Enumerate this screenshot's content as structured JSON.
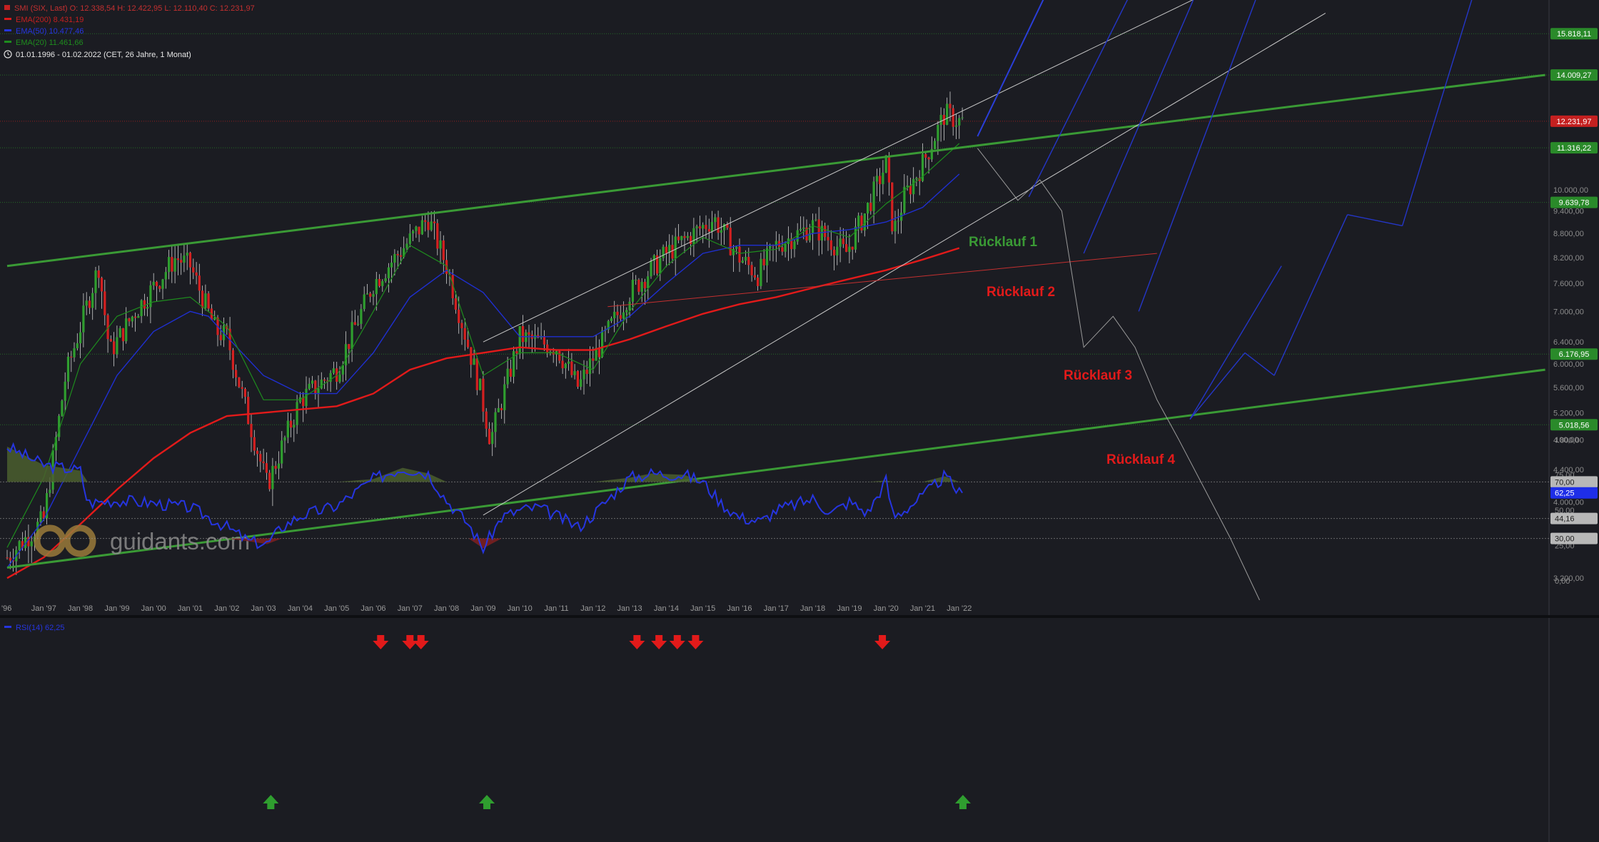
{
  "header": {
    "title_line": "SMI (SIX, Last)  O: 12.338,54  H: 12.422,95  L: 12.110,40  C: 12.231,97",
    "ema200": "EMA(200)  8.431,19",
    "ema50": "EMA(50)  10.477,46",
    "ema20": "EMA(20)  11.461,66",
    "range": "01.01.1996 - 01.02.2022   (CET, 26 Jahre, 1 Monat)"
  },
  "watermark": "guidants.com",
  "colors": {
    "background": "#1b1c22",
    "ema200": "#e21a1a",
    "ema50": "#1f2fd0",
    "ema20": "#1e8c1e",
    "channel": "#3a9a35",
    "up_candle": "#2f9e2f",
    "down_candle": "#d42020",
    "rsi_line": "#2635e0",
    "rsi_fill_high": "#4a5e2e",
    "rsi_fill_low": "#7a2020"
  },
  "chart_data": [
    {
      "type": "line",
      "name": "SMI monthly candlestick chart",
      "ylabel_scale": "log",
      "ylim": [
        3000,
        17500
      ],
      "x_ticks": [
        "'96",
        "Jan '97",
        "Jan '98",
        "Jan '99",
        "Jan '00",
        "Jan '01",
        "Jan '02",
        "Jan '03",
        "Jan '04",
        "Jan '05",
        "Jan '06",
        "Jan '07",
        "Jan '08",
        "Jan '09",
        "Jan '10",
        "Jan '11",
        "Jan '12",
        "Jan '13",
        "Jan '14",
        "Jan '15",
        "Jan '16",
        "Jan '17",
        "Jan '18",
        "Jan '19",
        "Jan '20",
        "Jan '21",
        "Jan '22"
      ],
      "y_ticks": [
        3200,
        3600,
        4000,
        4400,
        4800,
        5200,
        5600,
        6000,
        6400,
        7000,
        7600,
        8200,
        8800,
        9400,
        10000
      ],
      "y_tick_labels": [
        "3.200,00",
        "3.600,00",
        "4.000,00",
        "4.400,00",
        "4.800,00",
        "5.200,00",
        "5.600,00",
        "6.000,00",
        "6.400,00",
        "7.000,00",
        "7.600,00",
        "8.200,00",
        "8.800,00",
        "9.400,00",
        "10.000,00"
      ],
      "price_path": {
        "x": [
          1996.0,
          1997.0,
          1997.6,
          1998.5,
          1998.8,
          1999.5,
          2000.6,
          2001.0,
          2001.7,
          2002.0,
          2002.5,
          2003.1,
          2004.0,
          2005.0,
          2006.0,
          2007.5,
          2008.0,
          2008.9,
          2009.2,
          2010.0,
          2011.0,
          2011.6,
          2012.0,
          2013.0,
          2014.0,
          2015.3,
          2016.0,
          2016.5,
          2017.0,
          2018.0,
          2018.9,
          2019.5,
          2020.0,
          2020.2,
          2020.5,
          2021.0,
          2021.6,
          2022.0
        ],
        "close": [
          3400,
          3800,
          5800,
          8000,
          6200,
          7000,
          8200,
          8000,
          6600,
          6500,
          5300,
          4200,
          5400,
          5900,
          7600,
          9200,
          8000,
          5600,
          4800,
          6500,
          6300,
          5600,
          6100,
          7400,
          8300,
          9200,
          8200,
          7800,
          8500,
          9000,
          8300,
          9500,
          10800,
          8800,
          9800,
          10800,
          12500,
          12232
        ]
      },
      "series": [
        {
          "name": "EMA(200)",
          "x": [
            1996.0,
            1997.0,
            1998.0,
            1999.0,
            2000.0,
            2001.0,
            2002.0,
            2003.0,
            2004.0,
            2005.0,
            2006.0,
            2007.0,
            2008.0,
            2009.0,
            2010.0,
            2011.0,
            2012.0,
            2013.0,
            2014.0,
            2015.0,
            2016.0,
            2017.0,
            2018.0,
            2019.0,
            2020.0,
            2021.0,
            2022.0
          ],
          "values": [
            3200,
            3400,
            3750,
            4150,
            4550,
            4900,
            5150,
            5200,
            5250,
            5300,
            5500,
            5900,
            6100,
            6200,
            6300,
            6250,
            6250,
            6450,
            6700,
            6950,
            7150,
            7300,
            7500,
            7700,
            7900,
            8150,
            8431
          ]
        },
        {
          "name": "EMA(50)",
          "x": [
            1996.0,
            1997.0,
            1998.0,
            1999.0,
            2000.0,
            2001.0,
            2001.5,
            2002.0,
            2003.0,
            2004.0,
            2005.0,
            2006.0,
            2007.0,
            2008.0,
            2009.0,
            2010.0,
            2011.0,
            2012.0,
            2013.0,
            2014.0,
            2015.0,
            2016.0,
            2017.0,
            2018.0,
            2019.0,
            2020.0,
            2021.0,
            2022.0
          ],
          "values": [
            3300,
            3800,
            4700,
            5800,
            6600,
            7000,
            6900,
            6500,
            5800,
            5500,
            5500,
            6200,
            7300,
            7900,
            7400,
            6500,
            6500,
            6500,
            6900,
            7600,
            8300,
            8500,
            8500,
            8800,
            8900,
            9100,
            9500,
            10477
          ]
        },
        {
          "name": "EMA(20)",
          "x": [
            1996.0,
            1997.0,
            1998.0,
            1999.0,
            2000.0,
            2001.0,
            2002.0,
            2003.0,
            2004.0,
            2005.0,
            2006.0,
            2007.0,
            2008.0,
            2009.0,
            2010.0,
            2011.0,
            2012.0,
            2013.0,
            2014.0,
            2015.0,
            2016.0,
            2017.0,
            2018.0,
            2019.0,
            2020.0,
            2021.0,
            2022.0
          ],
          "values": [
            3500,
            4300,
            6000,
            6900,
            7200,
            7300,
            6700,
            5400,
            5400,
            5800,
            7000,
            8500,
            8000,
            5800,
            6200,
            6200,
            5900,
            7000,
            8000,
            8700,
            8300,
            8400,
            9000,
            8700,
            9600,
            10400,
            11462
          ]
        }
      ],
      "channel_lines": [
        {
          "name": "upper green",
          "x": [
            1996.0,
            2038.0
          ],
          "values": [
            8000,
            14009
          ]
        },
        {
          "name": "lower green",
          "x": [
            1996.0,
            2038.0
          ],
          "values": [
            3300,
            5900
          ]
        },
        {
          "name": "upper white",
          "x": [
            2009.0,
            2030.0
          ],
          "values": [
            6400,
            19000
          ]
        },
        {
          "name": "lower white",
          "x": [
            2009.0,
            2032.0
          ],
          "values": [
            3850,
            16800
          ]
        },
        {
          "name": "red trend",
          "x": [
            2012.4,
            2027.4
          ],
          "values": [
            7100,
            8300
          ]
        }
      ],
      "scenario_path": {
        "x": [
          2022.5,
          2023.6,
          2024.2,
          2024.8,
          2025.4,
          2026.2,
          2026.8,
          2027.4,
          2028.0,
          2029.4,
          2030.2
        ],
        "values": [
          11300,
          9700,
          10300,
          9400,
          6300,
          6900,
          6300,
          5400,
          4800,
          3600,
          3000
        ]
      },
      "projection_lines": [
        {
          "x": [
            2022.5,
            2024.3
          ],
          "values": [
            11700,
            17500
          ]
        },
        {
          "x": [
            2023.9,
            2026.6
          ],
          "values": [
            9800,
            17500
          ]
        },
        {
          "x": [
            2025.4,
            2028.4
          ],
          "values": [
            8300,
            17500
          ]
        },
        {
          "x": [
            2026.9,
            2030.1
          ],
          "values": [
            7000,
            17500
          ]
        },
        {
          "x": [
            2028.3,
            2030.8
          ],
          "values": [
            5100,
            8000
          ]
        },
        {
          "x": [
            2028.3,
            2029.8
          ],
          "values": [
            5100,
            6200
          ]
        },
        {
          "x": [
            2029.8,
            2030.6
          ],
          "values": [
            6200,
            5800
          ]
        },
        {
          "x": [
            2030.6,
            2032.6
          ],
          "values": [
            5800,
            9300
          ]
        },
        {
          "x": [
            2032.6,
            2034.1
          ],
          "values": [
            9300,
            9000
          ]
        },
        {
          "x": [
            2034.1,
            2036.0
          ],
          "values": [
            9000,
            17500
          ]
        }
      ],
      "horizontal_levels": [
        {
          "value": 15818.11,
          "label": "15.818,11",
          "color": "#2a8a2a"
        },
        {
          "value": 14009.27,
          "label": "14.009,27",
          "color": "#2a8a2a"
        },
        {
          "value": 12231.97,
          "label": "12.231,97",
          "color": "#c42020"
        },
        {
          "value": 11316.22,
          "label": "11.316,22",
          "color": "#2a8a2a"
        },
        {
          "value": 9639.78,
          "label": "9.639,78",
          "color": "#2a8a2a"
        },
        {
          "value": 6176.95,
          "label": "6.176,95",
          "color": "#2a8a2a"
        },
        {
          "value": 5018.56,
          "label": "5.018,56",
          "color": "#2a8a2a"
        }
      ],
      "annotations": [
        {
          "text": "Rücklauf 1",
          "color": "#3a9a35"
        },
        {
          "text": "Rücklauf 2",
          "color": "#e21a1a"
        },
        {
          "text": "Rücklauf 3",
          "color": "#e21a1a"
        },
        {
          "text": "Rücklauf 4",
          "color": "#e21a1a"
        }
      ]
    },
    {
      "type": "area",
      "name": "RSI panel",
      "legend": "RSI(14)  62,25",
      "ylim": [
        0,
        100
      ],
      "y_ticks": [
        0,
        25,
        50,
        75,
        100
      ],
      "y_tick_labels": [
        "0,00",
        "25,00",
        "50,00",
        "75,00",
        "100,00"
      ],
      "levels": [
        {
          "value": 70,
          "label": "70,00"
        },
        {
          "value": 44.16,
          "label": "44,16"
        },
        {
          "value": 30,
          "label": "30,00"
        }
      ],
      "current": {
        "value": 62.25,
        "label": "62,25"
      },
      "x": [
        1996.0,
        1997.0,
        1998.0,
        1998.2,
        1999.0,
        2000.0,
        2001.0,
        2002.0,
        2002.6,
        2003.1,
        2003.5,
        2004.0,
        2005.0,
        2006.0,
        2006.8,
        2007.5,
        2008.0,
        2008.6,
        2009.0,
        2009.5,
        2010.0,
        2010.5,
        2011.0,
        2011.6,
        2012.0,
        2013.0,
        2013.6,
        2014.5,
        2015.0,
        2015.5,
        2016.0,
        2016.6,
        2017.0,
        2018.0,
        2018.5,
        2019.0,
        2019.5,
        2020.0,
        2020.2,
        2020.6,
        2021.0,
        2021.6,
        2022.0
      ],
      "values": [
        95,
        82,
        78,
        55,
        57,
        55,
        52,
        38,
        28,
        26,
        38,
        46,
        53,
        72,
        80,
        76,
        57,
        40,
        23,
        45,
        50,
        52,
        46,
        38,
        47,
        73,
        76,
        75,
        70,
        55,
        45,
        42,
        50,
        58,
        48,
        56,
        48,
        71,
        45,
        52,
        60,
        74,
        62.25
      ]
    }
  ],
  "signals": {
    "sell_arrows_years": [
      2006.2,
      2007.0,
      2007.3,
      2013.2,
      2013.8,
      2014.3,
      2014.8,
      2019.9
    ],
    "buy_arrows_years": [
      2003.2,
      2009.1,
      2022.1
    ]
  }
}
